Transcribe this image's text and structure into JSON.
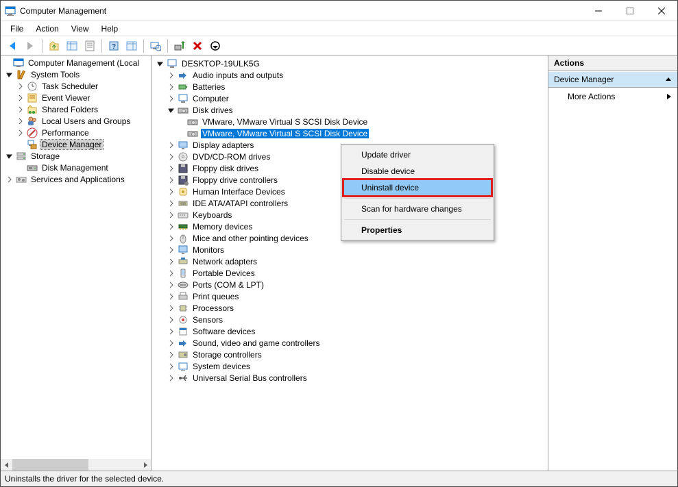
{
  "window": {
    "title": "Computer Management"
  },
  "menubar": {
    "items": [
      "File",
      "Action",
      "View",
      "Help"
    ]
  },
  "statusbar": {
    "text": "Uninstalls the driver for the selected device."
  },
  "actions": {
    "header": "Actions",
    "section": "Device Manager",
    "links": [
      "More Actions"
    ]
  },
  "left_tree": {
    "root": "Computer Management (Local",
    "system_tools": {
      "label": "System Tools",
      "children": [
        "Task Scheduler",
        "Event Viewer",
        "Shared Folders",
        "Local Users and Groups",
        "Performance",
        "Device Manager"
      ]
    },
    "storage": {
      "label": "Storage",
      "children": [
        "Disk Management"
      ]
    },
    "services_apps": {
      "label": "Services and Applications"
    }
  },
  "device_tree": {
    "root": "DESKTOP-19ULK5G",
    "groups": [
      {
        "label": "Audio inputs and outputs",
        "expanded": false
      },
      {
        "label": "Batteries",
        "expanded": false
      },
      {
        "label": "Computer",
        "expanded": false
      },
      {
        "label": "Disk drives",
        "expanded": true,
        "children": [
          "VMware, VMware Virtual S SCSI Disk Device",
          "VMware, VMware Virtual S SCSI Disk Device"
        ]
      },
      {
        "label": "Display adapters",
        "expanded": false
      },
      {
        "label": "DVD/CD-ROM drives",
        "expanded": false
      },
      {
        "label": "Floppy disk drives",
        "expanded": false
      },
      {
        "label": "Floppy drive controllers",
        "expanded": false
      },
      {
        "label": "Human Interface Devices",
        "expanded": false
      },
      {
        "label": "IDE ATA/ATAPI controllers",
        "expanded": false
      },
      {
        "label": "Keyboards",
        "expanded": false
      },
      {
        "label": "Memory devices",
        "expanded": false
      },
      {
        "label": "Mice and other pointing devices",
        "expanded": false
      },
      {
        "label": "Monitors",
        "expanded": false
      },
      {
        "label": "Network adapters",
        "expanded": false
      },
      {
        "label": "Portable Devices",
        "expanded": false
      },
      {
        "label": "Ports (COM & LPT)",
        "expanded": false
      },
      {
        "label": "Print queues",
        "expanded": false
      },
      {
        "label": "Processors",
        "expanded": false
      },
      {
        "label": "Sensors",
        "expanded": false
      },
      {
        "label": "Software devices",
        "expanded": false
      },
      {
        "label": "Sound, video and game controllers",
        "expanded": false
      },
      {
        "label": "Storage controllers",
        "expanded": false
      },
      {
        "label": "System devices",
        "expanded": false
      },
      {
        "label": "Universal Serial Bus controllers",
        "expanded": false
      }
    ]
  },
  "context_menu": {
    "items": [
      "Update driver",
      "Disable device",
      "Uninstall device",
      "Scan for hardware changes",
      "Properties"
    ],
    "separators_after_index": [
      2,
      3
    ],
    "default_index": 4,
    "highlight_index": 2
  }
}
